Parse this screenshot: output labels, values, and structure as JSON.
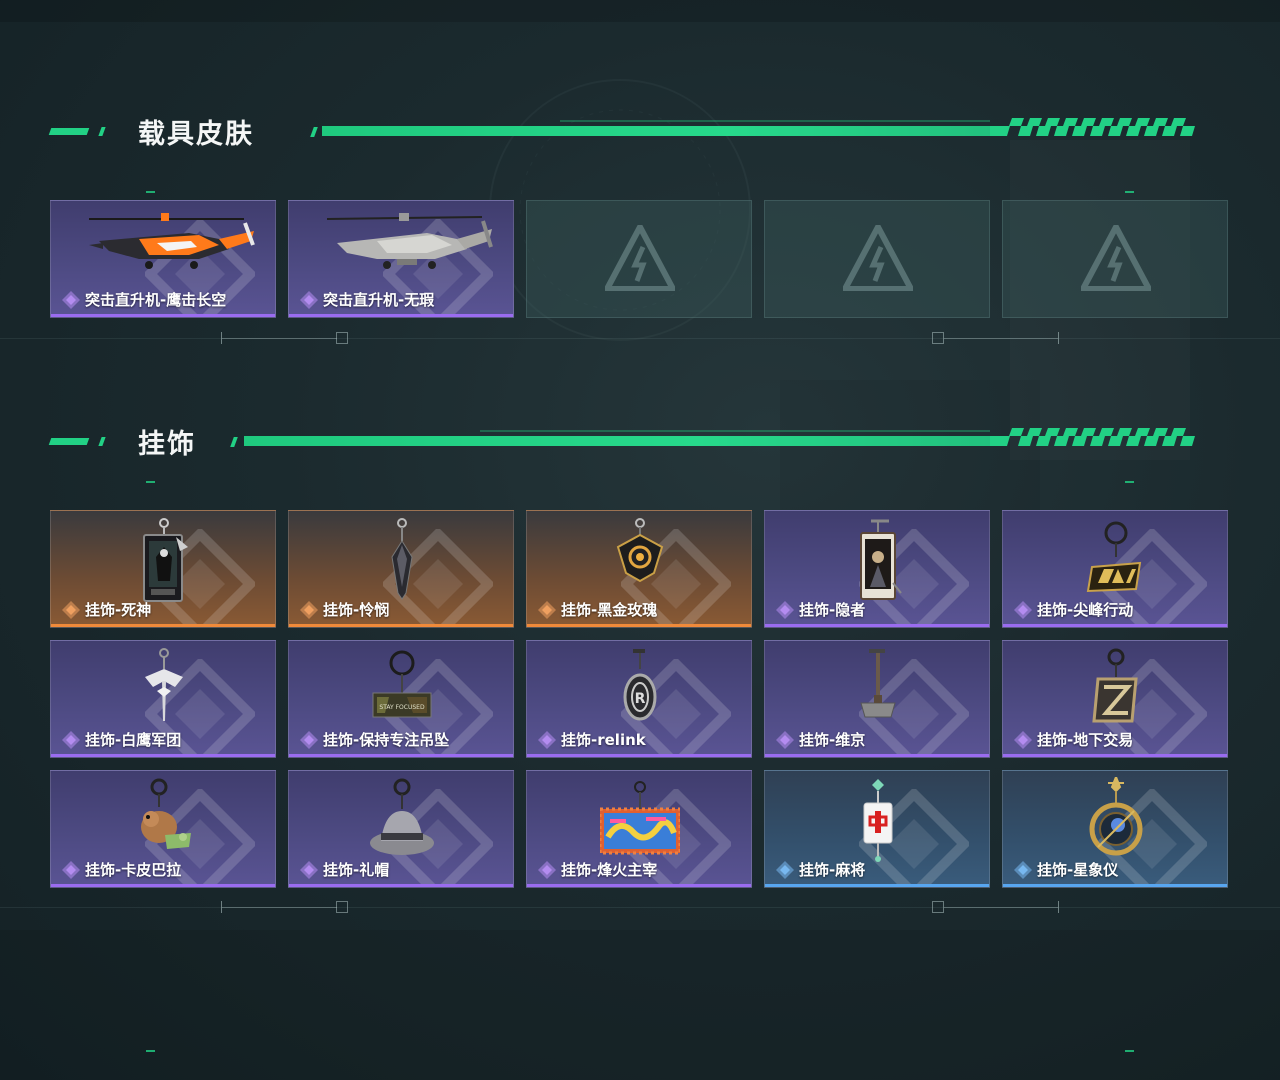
{
  "sections": [
    {
      "title": "载具皮肤",
      "items": [
        {
          "label": "突击直升机-鹰击长空",
          "rarity": "purple",
          "icon": "helicopter-orange-icon"
        },
        {
          "label": "突击直升机-无瑕",
          "rarity": "purple",
          "icon": "helicopter-grey-icon"
        },
        {
          "label": "",
          "rarity": "empty",
          "icon": "placeholder-logo-icon"
        },
        {
          "label": "",
          "rarity": "empty",
          "icon": "placeholder-logo-icon"
        },
        {
          "label": "",
          "rarity": "empty",
          "icon": "placeholder-logo-icon"
        }
      ]
    },
    {
      "title": "挂饰",
      "items": [
        {
          "label": "挂饰-死神",
          "rarity": "orange",
          "icon": "reaper-card-charm-icon"
        },
        {
          "label": "挂饰-怜悯",
          "rarity": "orange",
          "icon": "crystal-pendant-charm-icon"
        },
        {
          "label": "挂饰-黑金玫瑰",
          "rarity": "orange",
          "icon": "black-gold-rose-charm-icon"
        },
        {
          "label": "挂饰-隐者",
          "rarity": "purple",
          "icon": "hermit-card-charm-icon"
        },
        {
          "label": "挂饰-尖峰行动",
          "rarity": "purple",
          "icon": "peak-op-logo-charm-icon"
        },
        {
          "label": "挂饰-白鹰军团",
          "rarity": "purple",
          "icon": "white-eagle-charm-icon"
        },
        {
          "label": "挂饰-保持专注吊坠",
          "rarity": "purple",
          "icon": "stay-focused-tag-charm-icon"
        },
        {
          "label": "挂饰-relink",
          "rarity": "purple",
          "icon": "relink-r-charm-icon"
        },
        {
          "label": "挂饰-维京",
          "rarity": "purple",
          "icon": "viking-hammer-charm-icon"
        },
        {
          "label": "挂饰-地下交易",
          "rarity": "purple",
          "icon": "z-emblem-charm-icon"
        },
        {
          "label": "挂饰-卡皮巴拉",
          "rarity": "purple",
          "icon": "capybara-charm-icon"
        },
        {
          "label": "挂饰-礼帽",
          "rarity": "purple",
          "icon": "fedora-hat-charm-icon"
        },
        {
          "label": "挂饰-烽火主宰",
          "rarity": "purple",
          "icon": "graffiti-box-charm-icon"
        },
        {
          "label": "挂饰-麻将",
          "rarity": "blue",
          "icon": "mahjong-tile-charm-icon"
        },
        {
          "label": "挂饰-星象仪",
          "rarity": "blue",
          "icon": "astrolabe-charm-icon"
        }
      ]
    }
  ],
  "colors": {
    "accent": "#22d185",
    "purple": "#9a6cf0",
    "orange": "#f08a3a",
    "blue": "#58a6f0"
  },
  "stay_focused_text": "STAY FOCUSED"
}
